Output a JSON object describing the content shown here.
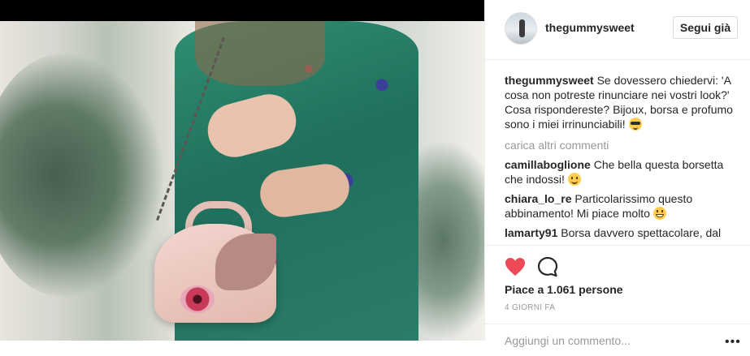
{
  "post": {
    "image_alt": "Woman in a green floral dress holding a pink handbag",
    "username": "thegummysweet",
    "follow_label": "Segui già",
    "caption": {
      "username": "thegummysweet",
      "text": "Se dovessero chiedervi: 'A cosa non potreste rinunciare nei vostri look?' Cosa rispondereste? Bijoux, borsa e profumo sono i miei irrinunciabili!"
    },
    "load_more": "carica altri commenti",
    "comments": [
      {
        "username": "camillaboglione",
        "text": "Che bella questa borsetta che indossi!"
      },
      {
        "username": "chiara_lo_re",
        "text": "Particolarissimo questo abbinamento! Mi piace molto"
      },
      {
        "username": "lamarty91",
        "text": "Borsa davvero spettacolare, dal"
      }
    ],
    "likes": "Piace a 1.061 persone",
    "time": "4 GIORNI FA",
    "comment_placeholder": "Aggiungi un commento...",
    "more_options": "•••"
  },
  "icons": {
    "like": "heart-icon",
    "comment": "comment-bubble-icon",
    "more": "more-options-icon"
  },
  "colors": {
    "like_red": "#ed4956",
    "muted": "#999999",
    "text": "#262626",
    "border": "#efefef"
  }
}
